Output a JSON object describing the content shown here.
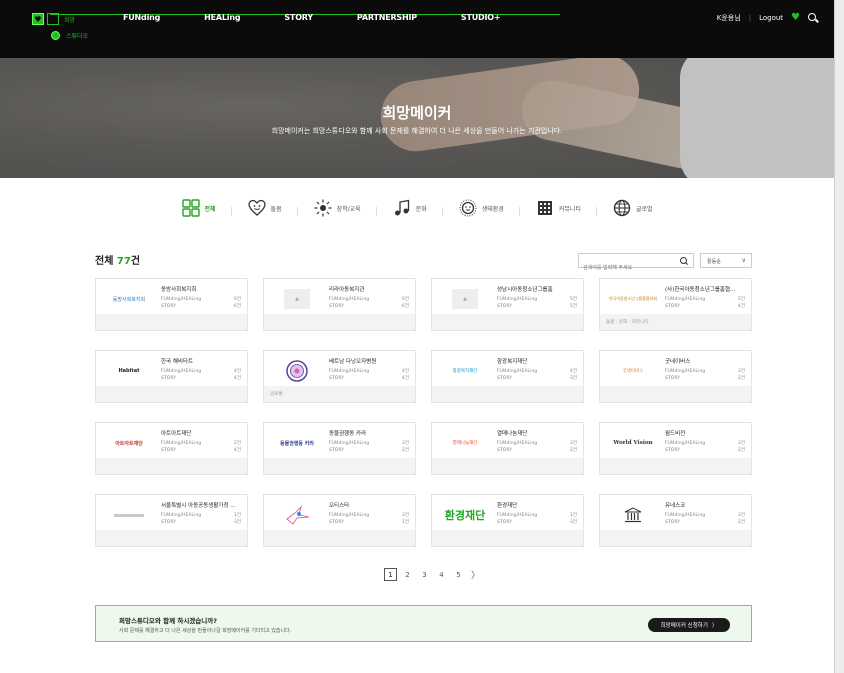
{
  "header": {
    "logo_text_top": "희망",
    "logo_text_bottom": "스튜디오",
    "nav": [
      "FUNding",
      "HEALing",
      "STORY",
      "PARTNERSHIP",
      "STUDIO+"
    ],
    "user": "K윤용님",
    "logout": "Logout"
  },
  "hero": {
    "title": "희망메이커",
    "subtitle": "희망메이커는 희망스튜디오와 함께 사회 문제를 해결하여 더 나은 세상을 만들어 나가는 기관입니다."
  },
  "categories": [
    {
      "label": "전체",
      "icon": "grid-icon",
      "active": true
    },
    {
      "label": "돌봄",
      "icon": "heart-face-icon",
      "active": false
    },
    {
      "label": "장학/교육",
      "icon": "sun-icon",
      "active": false
    },
    {
      "label": "문화",
      "icon": "music-icon",
      "active": false
    },
    {
      "label": "생태환경",
      "icon": "leaf-icon",
      "active": false
    },
    {
      "label": "커뮤니티",
      "icon": "building-icon",
      "active": false
    },
    {
      "label": "글로벌",
      "icon": "globe-icon",
      "active": false
    }
  ],
  "list": {
    "total_prefix": "전체 ",
    "total_count": "77",
    "total_suffix": "건",
    "search_placeholder": "검색어를 입력해 주세요",
    "sort_selected": "활동순"
  },
  "cards": [
    {
      "name": "동방사회복지회",
      "logo": "동방사회복지회",
      "funding_label": "FUNding/HEALing",
      "funding": "6건",
      "story_label": "STORY",
      "story": "6건",
      "tags": ""
    },
    {
      "name": "리라아동복지관",
      "logo": "",
      "funding_label": "FUNding/HEALing",
      "funding": "6건",
      "story_label": "STORY",
      "story": "6건",
      "tags": ""
    },
    {
      "name": "성남시아동청소년그룹홈",
      "logo": "",
      "funding_label": "FUNding/HEALing",
      "funding": "5건",
      "story_label": "STORY",
      "story": "5건",
      "tags": ""
    },
    {
      "name": "(사)한국아동청소년그룹홈협...",
      "logo": "한국아동청소년그룹홈협의회",
      "funding_label": "FUNding/HEALing",
      "funding": "5건",
      "story_label": "STORY",
      "story": "4건",
      "tags": "돌봄 · 문화 · 커뮤니티"
    },
    {
      "name": "한국 해비타트",
      "logo": "Habitat",
      "funding_label": "FUNding/HEALing",
      "funding": "4건",
      "story_label": "STORY",
      "story": "4건",
      "tags": ""
    },
    {
      "name": "베트남 다낭오자병원",
      "logo": "",
      "funding_label": "FUNding/HEALing",
      "funding": "4건",
      "story_label": "STORY",
      "story": "4건",
      "tags": "글로벌"
    },
    {
      "name": "항광복지재단",
      "logo": "항광복지재단",
      "funding_label": "FUNding/HEALing",
      "funding": "4건",
      "story_label": "STORY",
      "story": "3건",
      "tags": ""
    },
    {
      "name": "굿네이버스",
      "logo": "굿네이버스",
      "funding_label": "FUNding/HEALing",
      "funding": "3건",
      "story_label": "STORY",
      "story": "2건",
      "tags": ""
    },
    {
      "name": "아트아트재단",
      "logo": "아트아트재단",
      "funding_label": "FUNding/HEALing",
      "funding": "2건",
      "story_label": "STORY",
      "story": "4건",
      "tags": ""
    },
    {
      "name": "동물권행동 카라",
      "logo": "동물권행동 카라",
      "funding_label": "FUNding/HEALing",
      "funding": "3건",
      "story_label": "STORY",
      "story": "2건",
      "tags": ""
    },
    {
      "name": "열매나눔재단",
      "logo": "열매나눔재단",
      "funding_label": "FUNding/HEALing",
      "funding": "3건",
      "story_label": "STORY",
      "story": "2건",
      "tags": ""
    },
    {
      "name": "월드비전",
      "logo": "World Vision",
      "funding_label": "FUNding/HEALing",
      "funding": "3건",
      "story_label": "STORY",
      "story": "2건",
      "tags": ""
    },
    {
      "name": "서울특별시 아동공동생활가정 ...",
      "logo": "",
      "funding_label": "FUNding/HEALing",
      "funding": "1건",
      "story_label": "STORY",
      "story": "3건",
      "tags": ""
    },
    {
      "name": "오티스타",
      "logo": "",
      "funding_label": "FUNding/HEALing",
      "funding": "3건",
      "story_label": "STORY",
      "story": "1건",
      "tags": ""
    },
    {
      "name": "환경재단",
      "logo": "환경재단",
      "funding_label": "FUNding/HEALing",
      "funding": "1건",
      "story_label": "STORY",
      "story": "3건",
      "tags": ""
    },
    {
      "name": "유네스코",
      "logo": "",
      "funding_label": "FUNding/HEALing",
      "funding": "3건",
      "story_label": "STORY",
      "story": "2건",
      "tags": ""
    }
  ],
  "pagination": {
    "pages": [
      "1",
      "2",
      "3",
      "4",
      "5"
    ],
    "current": "1",
    "next": "〉"
  },
  "banner": {
    "title": "희망스튜디오와 함께 하시겠습니까?",
    "desc": "사회 문제를 해결하고 더 나은 세상을 만들어나갈 희망메이커를 기다리고 있습니다.",
    "button": "희망메이커 신청하기",
    "button_arrow": "〉"
  },
  "colors": {
    "accent": "#21a81f",
    "header_bg": "#0b0b0b",
    "banner_bg": "#ecf9ec"
  }
}
